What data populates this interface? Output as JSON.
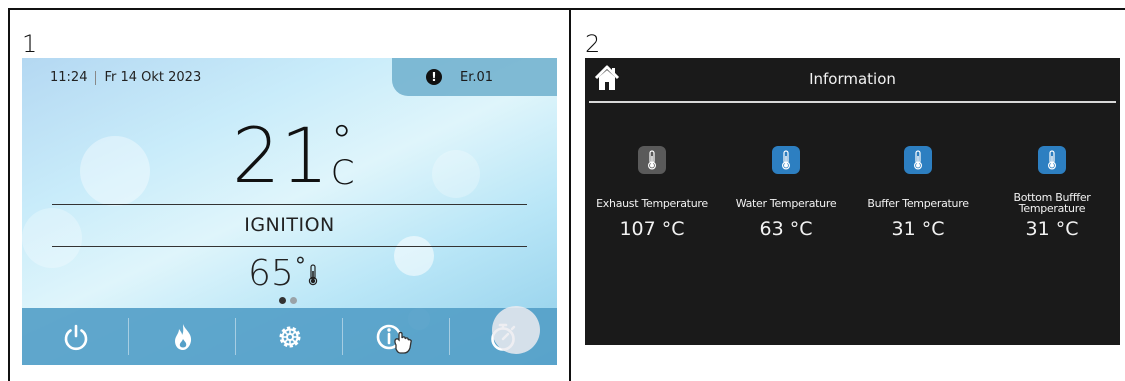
{
  "panel1": {
    "number": "1",
    "time": "11:24",
    "date": "Fr 14 Okt 2023",
    "error_code": "Er.01",
    "room_temp": "21",
    "room_temp_degree": "°",
    "room_temp_unit": "C",
    "state": "IGNITION",
    "water_temp": "65",
    "water_temp_degree": "°",
    "page_indicator": {
      "total": 2,
      "active": 1
    },
    "toolbar": [
      {
        "name": "power-button",
        "icon": "power-icon"
      },
      {
        "name": "flame-button",
        "icon": "flame-icon"
      },
      {
        "name": "settings-button",
        "icon": "gear-icon"
      },
      {
        "name": "info-button",
        "icon": "info-icon"
      },
      {
        "name": "timer-button",
        "icon": "stopwatch-icon"
      }
    ]
  },
  "panel2": {
    "number": "2",
    "title": "Information",
    "sensors": [
      {
        "label": "Exhaust Temperature",
        "value": "107 °C",
        "state": "inactive"
      },
      {
        "label": "Water Temperature",
        "value": "63 °C",
        "state": "active"
      },
      {
        "label": "Buffer Temperature",
        "value": "31 °C",
        "state": "active"
      },
      {
        "label": "Bottom Bufffer Temperature",
        "value": "31 °C",
        "state": "active"
      }
    ]
  },
  "colors": {
    "screen1_toolbar": "#55a0c8",
    "screen2_bg": "#1a1a1a",
    "sensor_active": "#2d7fc1",
    "sensor_inactive": "#5a5a5a"
  }
}
